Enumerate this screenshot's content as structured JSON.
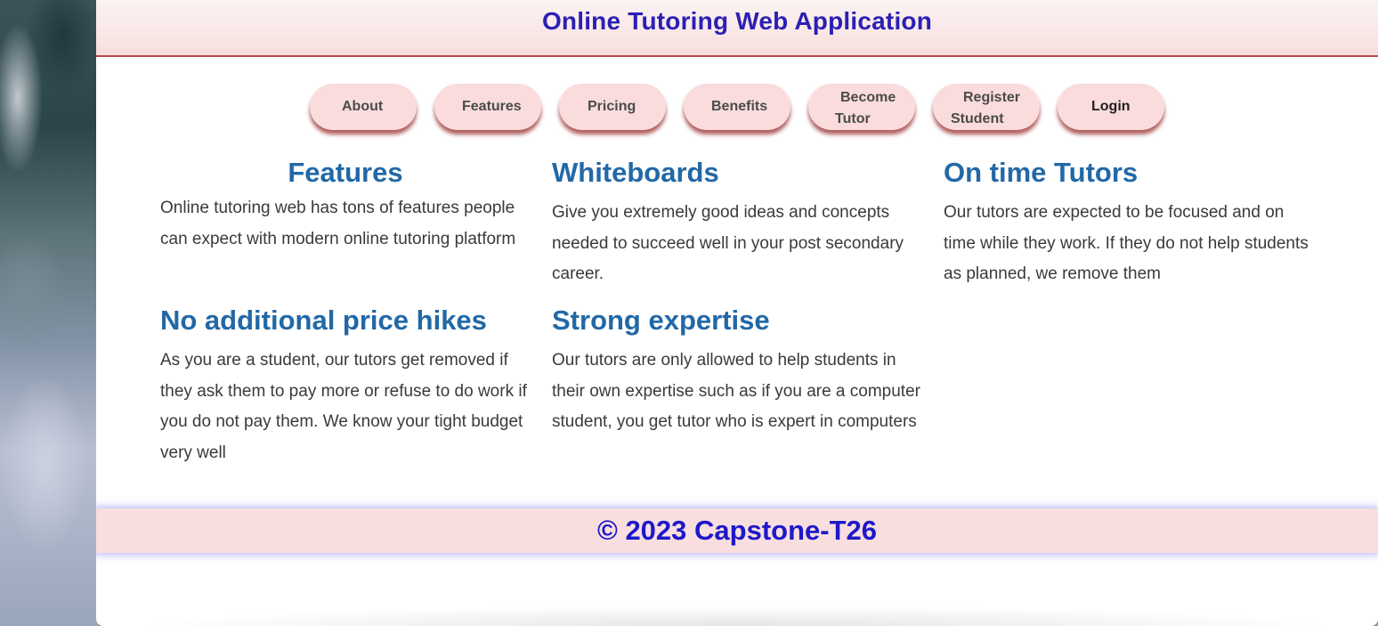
{
  "header": {
    "title": "Online Tutoring Web Application"
  },
  "nav": {
    "about": "About",
    "features": "Features",
    "pricing": "Pricing",
    "benefits": "Benefits",
    "become_tutor_line1": "Become",
    "become_tutor_line2": "Tutor",
    "register_student_line1": "Register",
    "register_student_line2": "Student",
    "login": "Login"
  },
  "sections": {
    "features": {
      "title": "Features",
      "text": "Online tutoring web has tons of features people can expect with modern online tutoring platform"
    },
    "whiteboards": {
      "title": "Whiteboards",
      "text": "Give you extremely good ideas and concepts needed to succeed well in your post secondary career."
    },
    "on_time_tutors": {
      "title": "On time Tutors",
      "text": "Our tutors are expected to be focused and on time while they work. If they do not help students as planned, we remove them"
    },
    "no_price_hikes": {
      "title": "No additional price hikes",
      "text": "As you are a student, our tutors get removed if they ask them to pay more or refuse to do work if you do not pay them. We know your tight budget very well"
    },
    "strong_expertise": {
      "title": "Strong expertise",
      "text": "Our tutors are only allowed to help students in their own expertise such as if you are a computer student, you get tutor who is expert in computers"
    }
  },
  "footer": {
    "text": "© 2023 Capstone-T26"
  },
  "colors": {
    "header_title": "#2b20b3",
    "section_title": "#2268a6",
    "nav_button_bg": "#fadcdc",
    "footer_bg": "#f8dedf",
    "footer_text": "#1d18c9"
  }
}
